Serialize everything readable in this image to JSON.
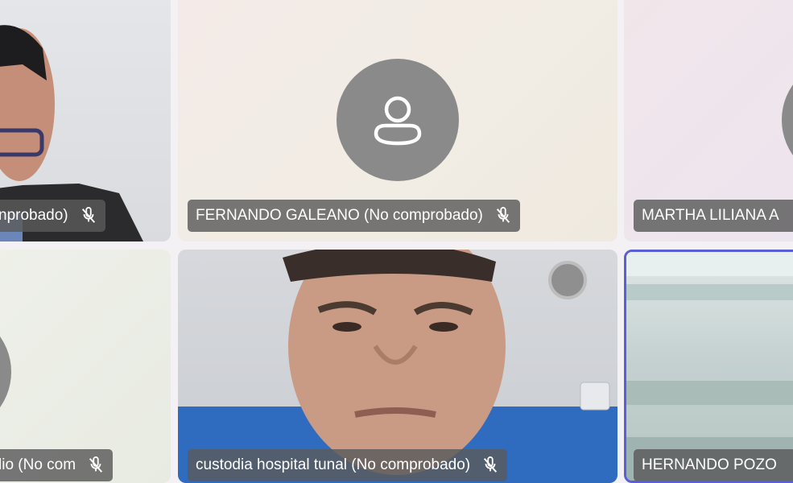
{
  "participants": [
    {
      "id": "p1",
      "name": "nprobado)",
      "camera": true,
      "muted": true
    },
    {
      "id": "p2",
      "name": "FERNANDO GALEANO (No comprobado)",
      "camera": false,
      "muted": true
    },
    {
      "id": "p3",
      "name": "MARTHA LILIANA A",
      "camera": false,
      "muted": false
    },
    {
      "id": "p4",
      "name": "lio (No com",
      "camera": false,
      "muted": true
    },
    {
      "id": "p5",
      "name": "custodia hospital tunal (No comprobado)",
      "camera": true,
      "muted": true
    },
    {
      "id": "p6",
      "name": "HERNANDO POZO",
      "camera": true,
      "muted": false
    }
  ],
  "icons": {
    "avatar": "person-icon",
    "mic": "mic-off-icon"
  },
  "colors": {
    "active_border": "#5b5fd6",
    "avatar_bg": "#8a8a8a",
    "tag_bg": "#5a5a5a"
  }
}
